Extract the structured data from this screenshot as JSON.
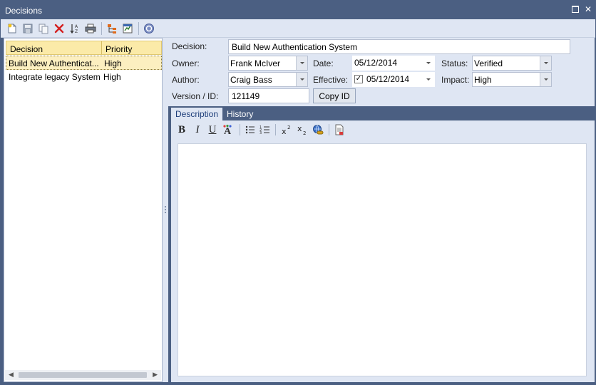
{
  "window": {
    "title": "Decisions"
  },
  "toolbar": {
    "buttons": [
      "new-icon",
      "save-icon",
      "copy-icon",
      "delete-icon",
      "sort-icon",
      "print-icon",
      "hierarchy-icon",
      "report-icon",
      "help-icon"
    ]
  },
  "list": {
    "columns": [
      "Decision",
      "Priority"
    ],
    "rows": [
      {
        "decision": "Build New Authenticat...",
        "priority": "High",
        "selected": true
      },
      {
        "decision": "Integrate legacy System",
        "priority": "High",
        "selected": false
      }
    ]
  },
  "form": {
    "decision_label": "Decision:",
    "decision_value": "Build New Authentication System",
    "owner_label": "Owner:",
    "owner_value": "Frank McIver",
    "date_label": "Date:",
    "date_value": "05/12/2014",
    "status_label": "Status:",
    "status_value": "Verified",
    "author_label": "Author:",
    "author_value": "Craig Bass",
    "effective_label": "Effective:",
    "effective_value": "05/12/2014",
    "effective_checked": true,
    "impact_label": "Impact:",
    "impact_value": "High",
    "version_label": "Version / ID:",
    "version_value": "121149",
    "copy_id_label": "Copy ID"
  },
  "tabs": [
    {
      "label": "Description",
      "active": true
    },
    {
      "label": "History",
      "active": false
    }
  ],
  "editor": {
    "bold": "B",
    "italic": "I",
    "underline": "U",
    "content": ""
  },
  "colors": {
    "frame": "#4b5f82",
    "toolbar_bg": "#dfe6f3",
    "list_header": "#fbeaa8",
    "selected_row": "#fcefc0",
    "active_tab_text": "#1e3e7a"
  }
}
